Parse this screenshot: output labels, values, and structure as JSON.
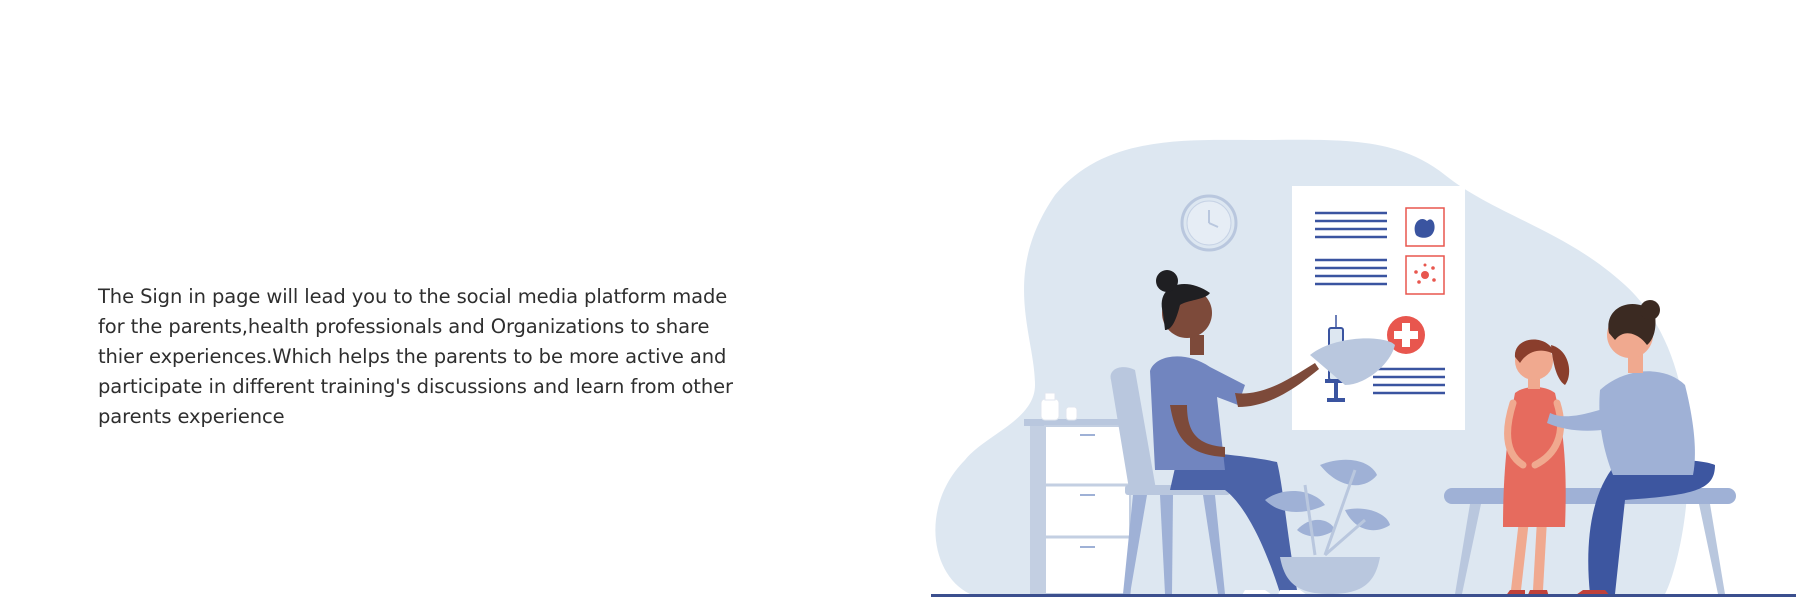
{
  "intro": {
    "text": "The Sign in page will lead you to the social media platform made for the parents,health professionals and Organizations to share thier experiences.Which helps the parents to be more active and participate in different training's discussions and learn from other parents experience"
  },
  "illustration": {
    "icon": "doctor-visit-illustration",
    "colors": {
      "blob": "#dde7f1",
      "navy": "#2f4a8f",
      "scrub": "#6d7fb8",
      "light_blue": "#9fb1d6",
      "red_cross": "#e8564e",
      "dress": "#e66b5e",
      "poster": "#ffffff",
      "floor": "#3b4f8e"
    }
  }
}
